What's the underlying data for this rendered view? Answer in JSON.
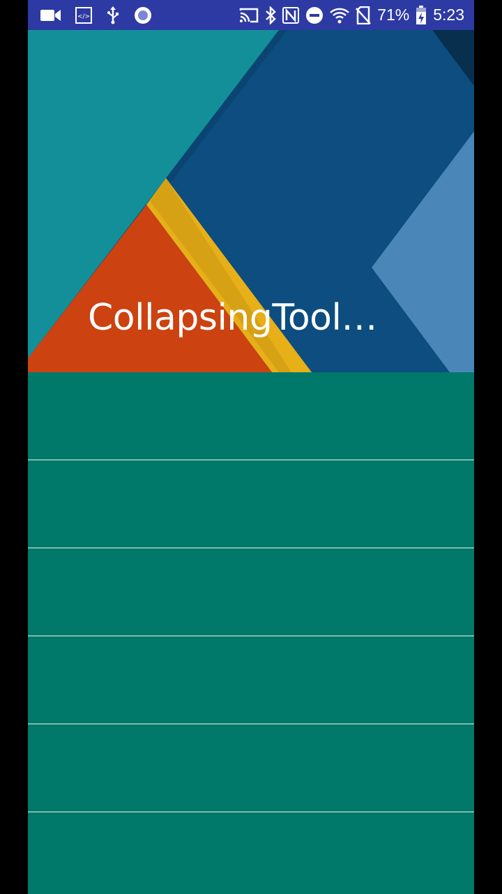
{
  "status_bar": {
    "battery_percent": "71%",
    "time": "5:23",
    "left_icons": [
      "video-camera-icon",
      "code-icon",
      "usb-icon",
      "circle-app-icon"
    ],
    "right_icons": [
      "cast-icon",
      "bluetooth-icon",
      "nfc-icon",
      "do-not-disturb-icon",
      "wifi-icon",
      "no-sim-icon",
      "battery-charging-icon"
    ]
  },
  "toolbar": {
    "title": "CollapsingToolbarLayout"
  },
  "list": {
    "items": [
      {
        "label": ""
      },
      {
        "label": ""
      },
      {
        "label": ""
      },
      {
        "label": ""
      },
      {
        "label": ""
      },
      {
        "label": ""
      }
    ]
  },
  "colors": {
    "status_bar": "#2d3aa3",
    "list_background": "#00796b",
    "header_teal": "#138f99",
    "header_blue": "#0d4d7f",
    "header_orange": "#cc4210",
    "header_yellow": "#e7b018",
    "header_light_blue": "#4a86b8"
  }
}
